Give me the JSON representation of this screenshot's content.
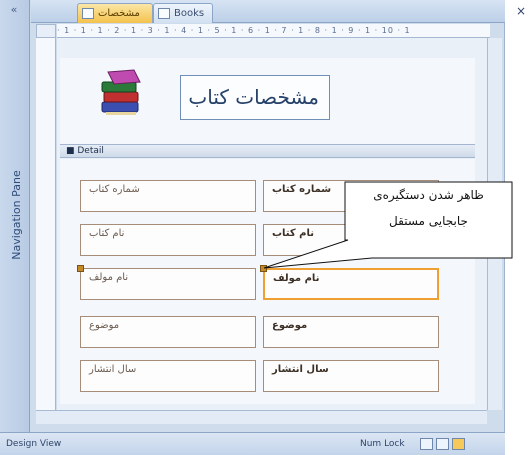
{
  "navigation_pane": {
    "label": "Navigation Pane",
    "toggle_glyph": "«"
  },
  "tabs": [
    {
      "label": "مشخصات کتاب",
      "active": true,
      "icon": "form-icon"
    },
    {
      "label": "Books",
      "active": false,
      "icon": "table-icon"
    }
  ],
  "close_glyph": "×",
  "ruler_ticks": "· 1 · 1 · 1 · 2 · 1 · 3 · 1 · 4 · 1 · 5 · 1 · 6 · 1 · 7 · 1 · 8 · 1 · 9 · 1 · 10 · 1",
  "form_header": {
    "title": "مشخصات کتاب",
    "image_icon": "books-icon"
  },
  "detail_section": {
    "label": "Detail"
  },
  "rows": [
    {
      "label": "شماره کتاب",
      "field": "شماره کتاب"
    },
    {
      "label": "نام کتاب",
      "field": "نام کتاب"
    },
    {
      "label": "نام مولف",
      "field": "نام مولف"
    },
    {
      "label": "موضوع",
      "field": "موضوع"
    },
    {
      "label": "سال انتشار",
      "field": "سال انتشار"
    }
  ],
  "callout": {
    "line1": "ظاهر شدن دستگیره‌ی",
    "line2": "جابجایی مستقل"
  },
  "status_bar": {
    "left": "Design View",
    "right": "Num Lock"
  },
  "colors": {
    "accent": "#f0a030",
    "frame": "#cfdcec",
    "handle": "#c48a28"
  }
}
